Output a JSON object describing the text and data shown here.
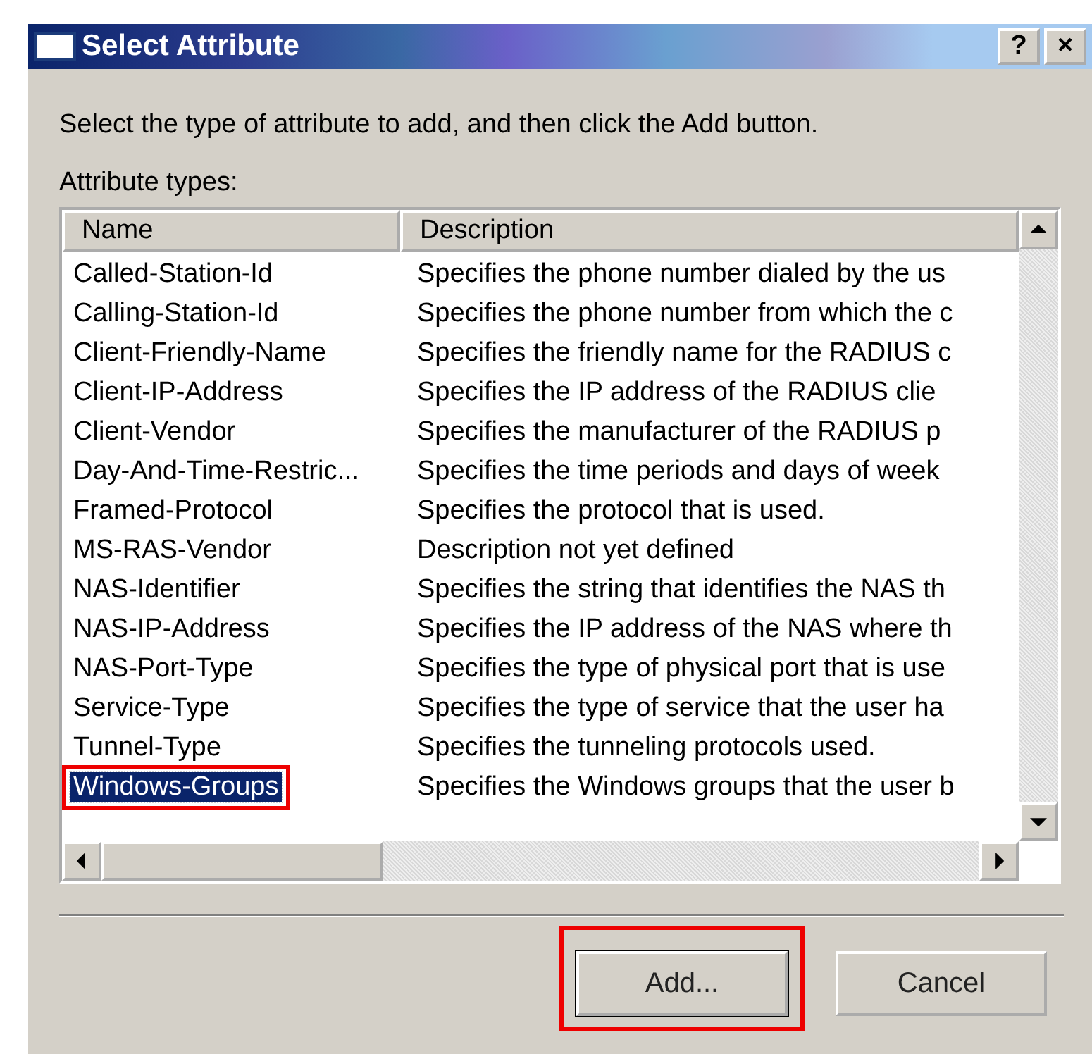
{
  "window": {
    "title": "Select Attribute",
    "controls": [
      "?",
      "×"
    ]
  },
  "instruction": "Select the type of attribute to add, and then click the Add button.",
  "list_label": "Attribute types:",
  "table": {
    "columns": [
      "Name",
      "Description"
    ],
    "rows": [
      {
        "name": "Called-Station-Id",
        "description": "Specifies the phone number dialed by the us",
        "selected": false,
        "highlighted": false
      },
      {
        "name": "Calling-Station-Id",
        "description": "Specifies the phone number from which the c",
        "selected": false,
        "highlighted": false
      },
      {
        "name": "Client-Friendly-Name",
        "description": "Specifies the friendly name for the RADIUS c",
        "selected": false,
        "highlighted": false
      },
      {
        "name": "Client-IP-Address",
        "description": "Specifies the IP address of the RADIUS clie",
        "selected": false,
        "highlighted": false
      },
      {
        "name": "Client-Vendor",
        "description": "Specifies the manufacturer of the RADIUS p",
        "selected": false,
        "highlighted": false
      },
      {
        "name": "Day-And-Time-Restric...",
        "description": "Specifies the time periods and days of week",
        "selected": false,
        "highlighted": false
      },
      {
        "name": "Framed-Protocol",
        "description": "Specifies the protocol that is used.",
        "selected": false,
        "highlighted": false
      },
      {
        "name": "MS-RAS-Vendor",
        "description": "Description not yet defined",
        "selected": false,
        "highlighted": false
      },
      {
        "name": "NAS-Identifier",
        "description": "Specifies the string that identifies the NAS th",
        "selected": false,
        "highlighted": false
      },
      {
        "name": "NAS-IP-Address",
        "description": "Specifies the IP address of the NAS where th",
        "selected": false,
        "highlighted": false
      },
      {
        "name": "NAS-Port-Type",
        "description": "Specifies the type of physical port that is use",
        "selected": false,
        "highlighted": false
      },
      {
        "name": "Service-Type",
        "description": "Specifies the type of service that the user ha",
        "selected": false,
        "highlighted": false
      },
      {
        "name": "Tunnel-Type",
        "description": "Specifies the tunneling protocols used.",
        "selected": false,
        "highlighted": false
      },
      {
        "name": "Windows-Groups",
        "description": "Specifies the Windows groups that the user b",
        "selected": true,
        "highlighted": true
      }
    ]
  },
  "buttons": [
    {
      "label": "Add...",
      "highlighted": true
    },
    {
      "label": "Cancel",
      "highlighted": false
    }
  ]
}
